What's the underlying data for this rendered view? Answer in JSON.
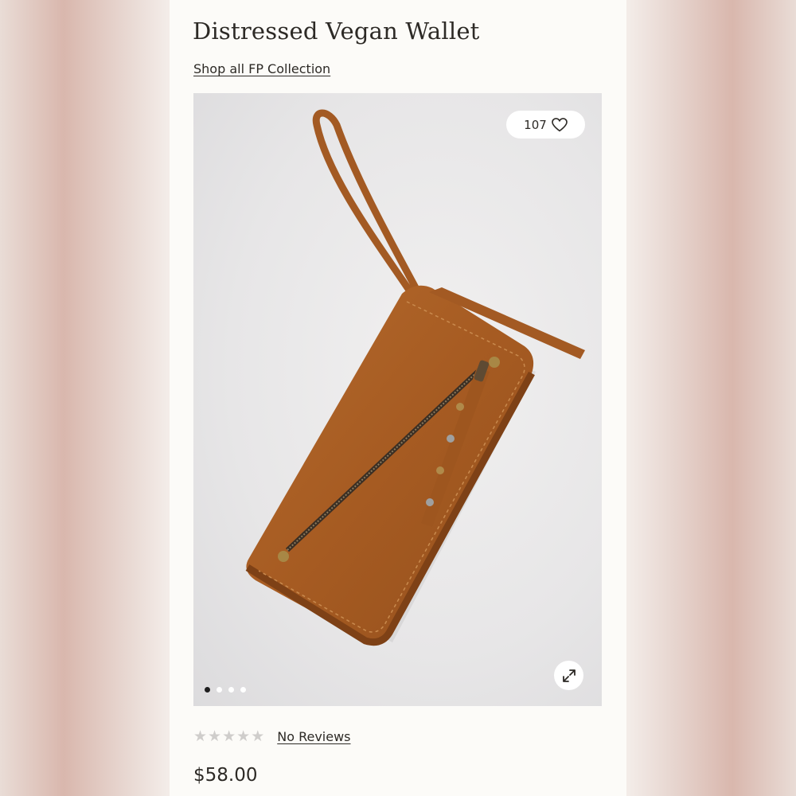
{
  "product": {
    "title": "Distressed Vegan Wallet",
    "collection_link": "Shop all FP Collection",
    "likes": "107",
    "rating_stars": 0,
    "reviews_link": "No Reviews",
    "price": "$58.00"
  },
  "gallery": {
    "image_count": 4,
    "active_index": 0
  },
  "icons": {
    "like": "heart-icon",
    "expand": "expand-icon",
    "star": "star-icon"
  },
  "colors": {
    "text": "#2d2a26",
    "wallet": "#a4581f",
    "star_empty": "#cfcdcb"
  }
}
